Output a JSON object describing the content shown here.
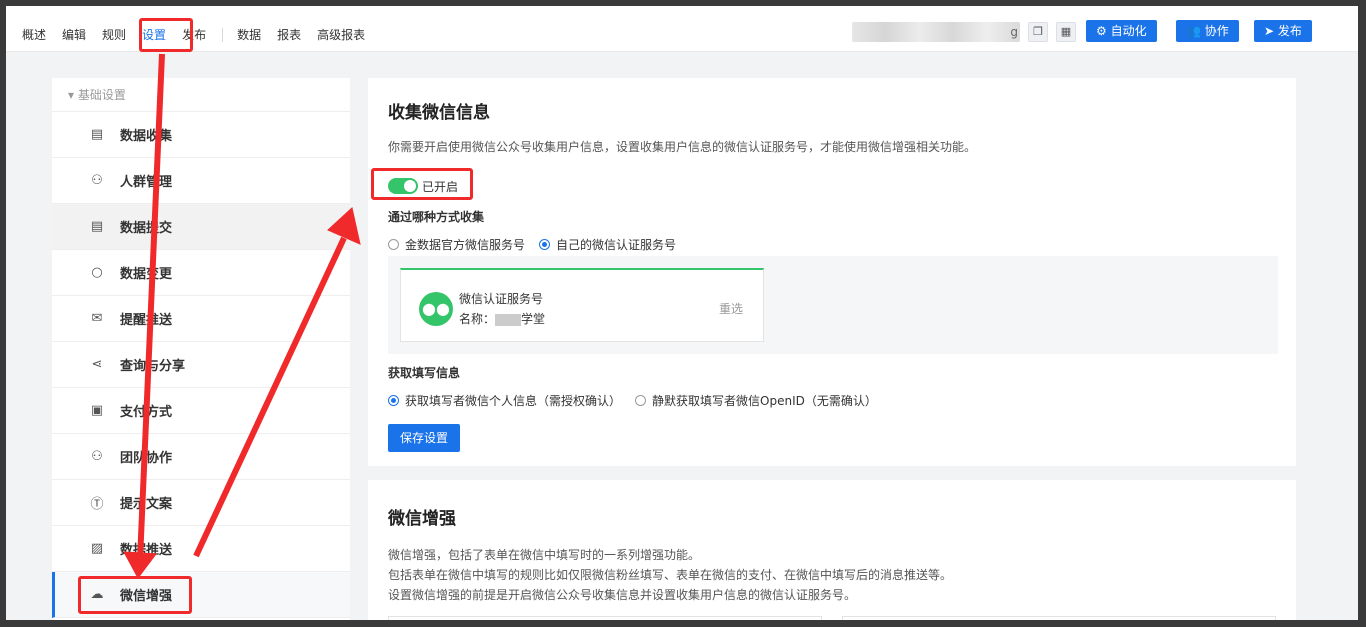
{
  "topnav": {
    "items": [
      "概述",
      "编辑",
      "规则",
      "设置",
      "发布"
    ],
    "items2": [
      "数据",
      "报表",
      "高级报表"
    ],
    "active": "设置",
    "search_suffix": "g",
    "buttons": {
      "automation": "自动化",
      "collaborate": "协作",
      "publish": "发布"
    }
  },
  "sidebar": {
    "group": "基础设置",
    "items": [
      {
        "label": "数据收集",
        "icon": "document-icon"
      },
      {
        "label": "人群管理",
        "icon": "user-group-icon"
      },
      {
        "label": "数据提交",
        "icon": "submit-icon"
      },
      {
        "label": "数据变更",
        "icon": "data-change-icon"
      },
      {
        "label": "提醒推送",
        "icon": "reminder-icon"
      },
      {
        "label": "查询与分享",
        "icon": "share-icon"
      },
      {
        "label": "支付方式",
        "icon": "wallet-icon"
      },
      {
        "label": "团队协作",
        "icon": "team-icon"
      },
      {
        "label": "提示文案",
        "icon": "text-icon"
      },
      {
        "label": "数据推送",
        "icon": "chart-icon"
      },
      {
        "label": "微信增强",
        "icon": "wechat-icon"
      }
    ]
  },
  "collect": {
    "title": "收集微信信息",
    "desc": "你需要开启使用微信公众号收集用户信息，设置收集用户信息的微信认证服务号，才能使用微信增强相关功能。",
    "toggle_label": "已开启",
    "method_label": "通过哪种方式收集",
    "method_options": [
      "金数据官方微信服务号",
      "自己的微信认证服务号"
    ],
    "method_selected": 1,
    "account_type": "微信认证服务号",
    "account_name_prefix": "名称：",
    "account_name": "学堂",
    "reselect": "重选",
    "fill_label": "获取填写信息",
    "fill_options": [
      "获取填写者微信个人信息（需授权确认）",
      "静默获取填写者微信OpenID（无需确认）"
    ],
    "fill_selected": 0,
    "save": "保存设置"
  },
  "enhance": {
    "title": "微信增强",
    "lines": [
      "微信增强，包括了表单在微信中填写时的一系列增强功能。",
      "包括表单在微信中填写的规则比如仅限微信粉丝填写、表单在微信的支付、在微信中填写后的消息推送等。",
      "设置微信增强的前提是开启微信公众号收集信息并设置收集用户信息的微信认证服务号。"
    ]
  }
}
